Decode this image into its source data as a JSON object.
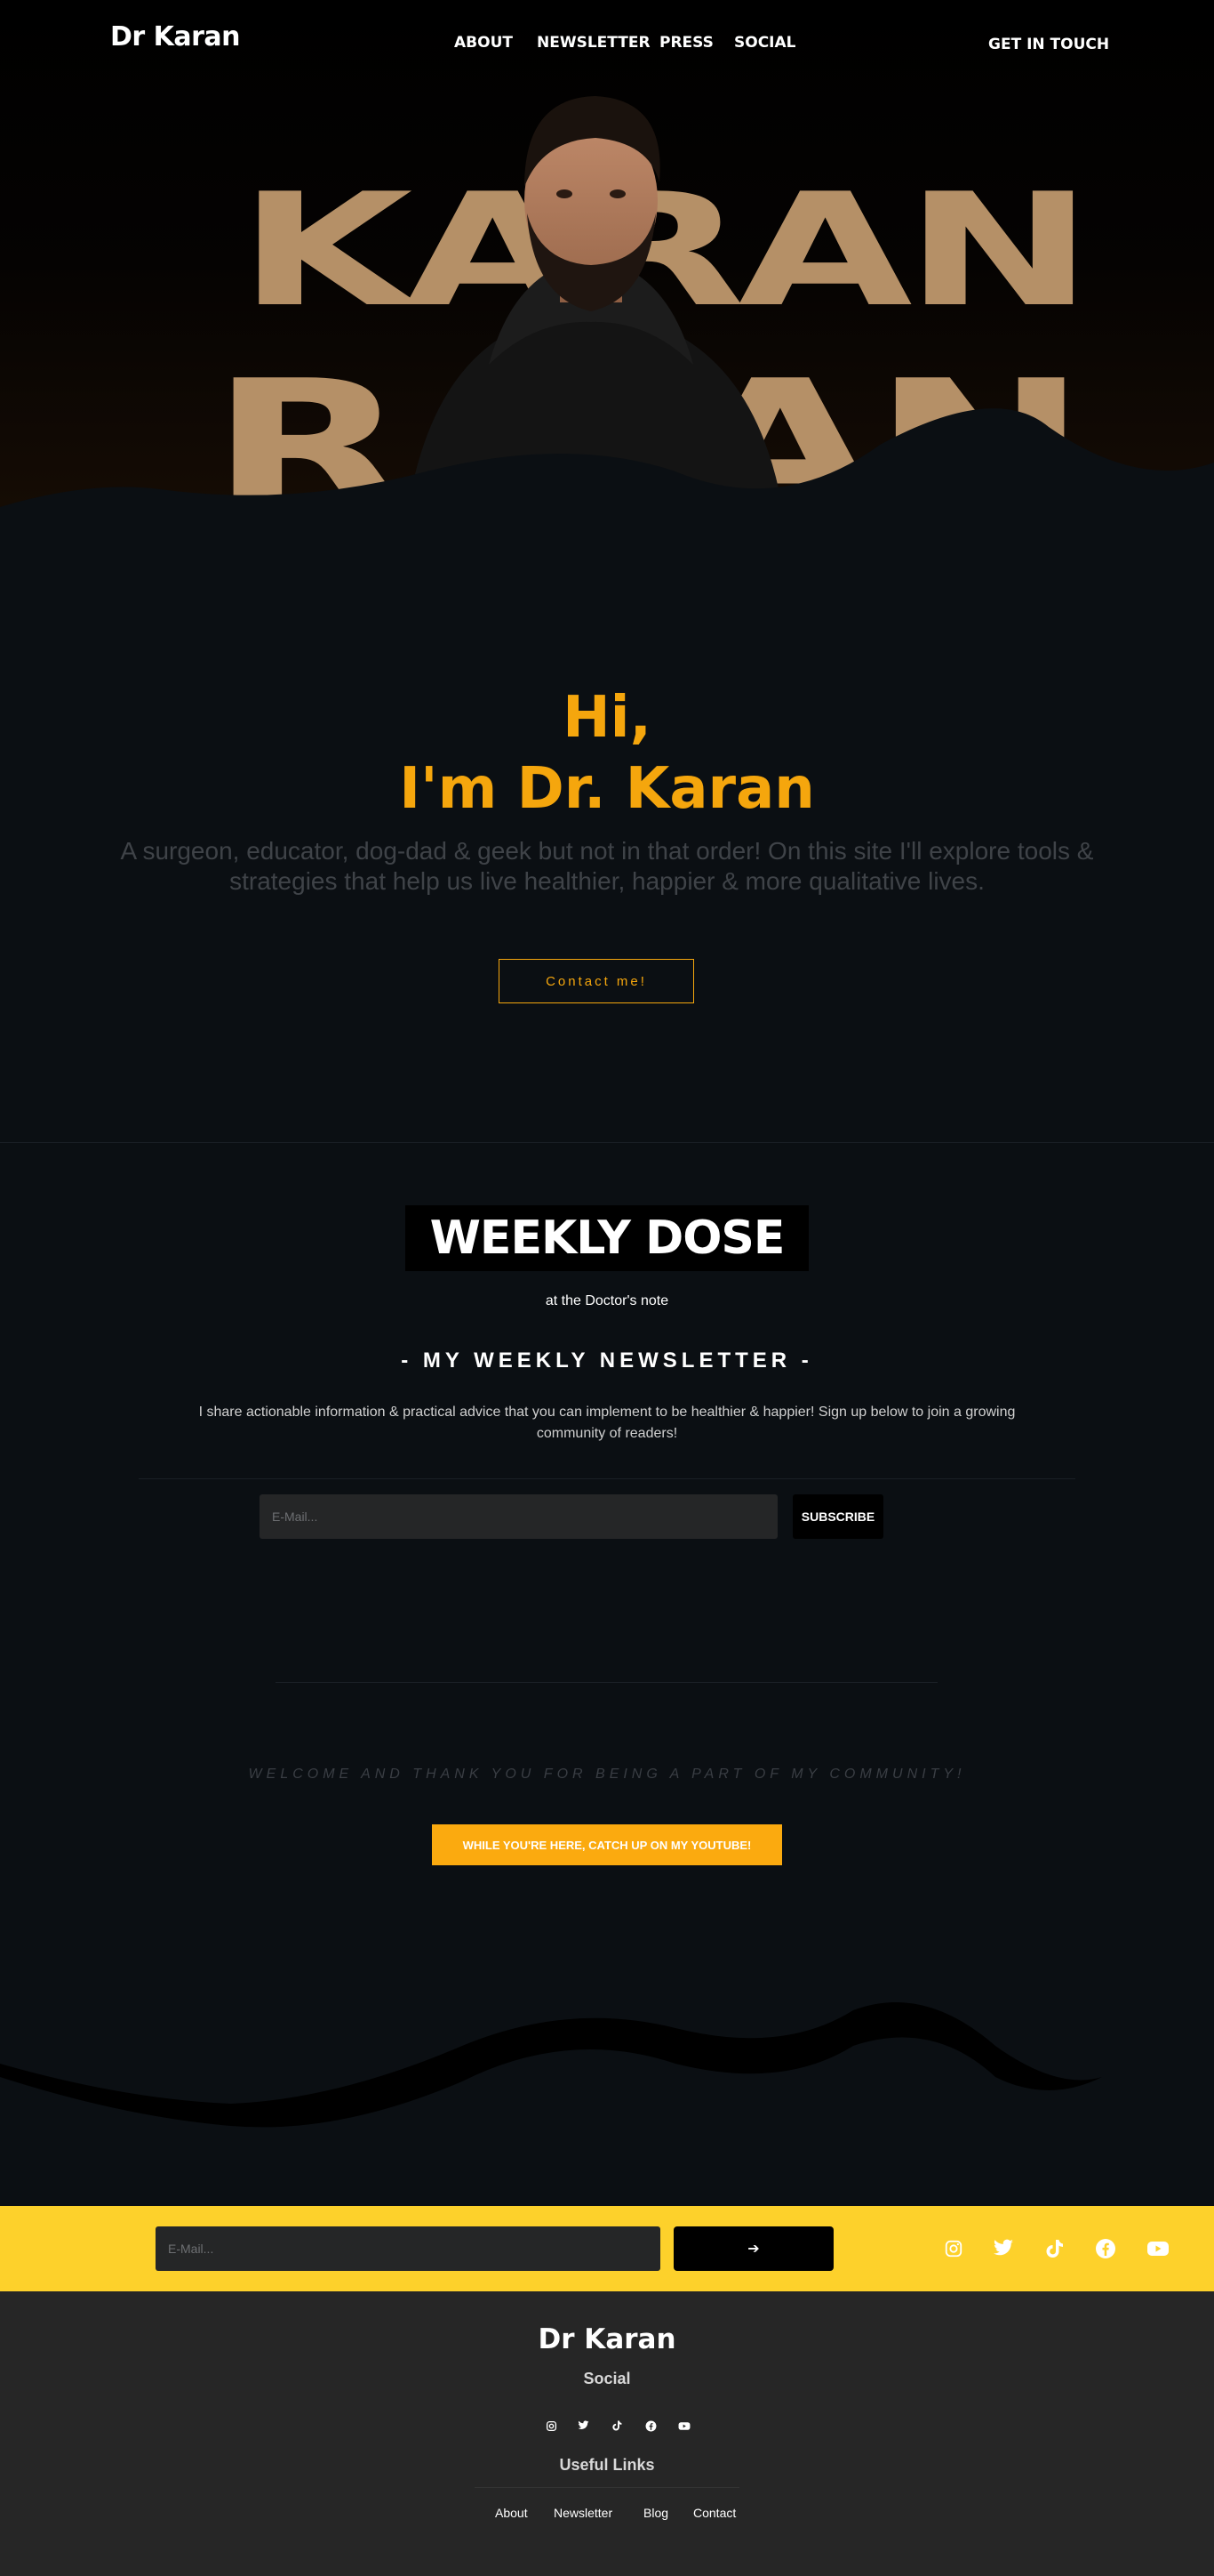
{
  "header": {
    "logo": "Dr Karan",
    "nav": [
      "ABOUT",
      "NEWSLETTER",
      "PRESS",
      "SOCIAL"
    ],
    "cta": "GET IN TOUCH"
  },
  "hero": {
    "word_top": "KARAN",
    "word_bottom": "RAJAN"
  },
  "intro": {
    "greeting": "Hi,",
    "name_line": "I'm Dr. Karan",
    "text": "A surgeon, educator, dog-dad & geek but not in that order! On this site I'll explore tools & strategies that help us live healthier, happier & more qualitative lives.",
    "contact_button": "Contact me!"
  },
  "newsletter": {
    "logo_title": "WEEKLY DOSE",
    "logo_sub": "at the Doctor's note",
    "heading": "- MY WEEKLY NEWSLETTER -",
    "description": "I share actionable information & practical advice that you can implement to be healthier & happier! Sign up below to join a growing community of readers!",
    "email_placeholder": "E-Mail...",
    "subscribe_button": "SUBSCRIBE",
    "welcome": "WELCOME AND THANK YOU FOR BEING A PART OF MY COMMUNITY!",
    "youtube_button": "WHILE YOU'RE HERE, CATCH UP ON MY YOUTUBE!"
  },
  "subscribe_bar": {
    "email_placeholder": "E-Mail...",
    "arrow": "➔",
    "bar_color": "#fdd12b",
    "social_icons": [
      "instagram-icon",
      "twitter-icon",
      "tiktok-icon",
      "facebook-icon",
      "youtube-icon"
    ]
  },
  "footer": {
    "logo": "Dr Karan",
    "social_heading": "Social",
    "social_icons": [
      "instagram-icon",
      "twitter-icon",
      "tiktok-icon",
      "facebook-icon",
      "youtube-icon"
    ],
    "links_heading": "Useful Links",
    "links": [
      "About",
      "Newsletter",
      "Blog",
      "Contact"
    ]
  },
  "colors": {
    "accent": "#f5a60d",
    "hero_text": "#b59067",
    "background": "#0b0f13",
    "footer": "#262626"
  }
}
